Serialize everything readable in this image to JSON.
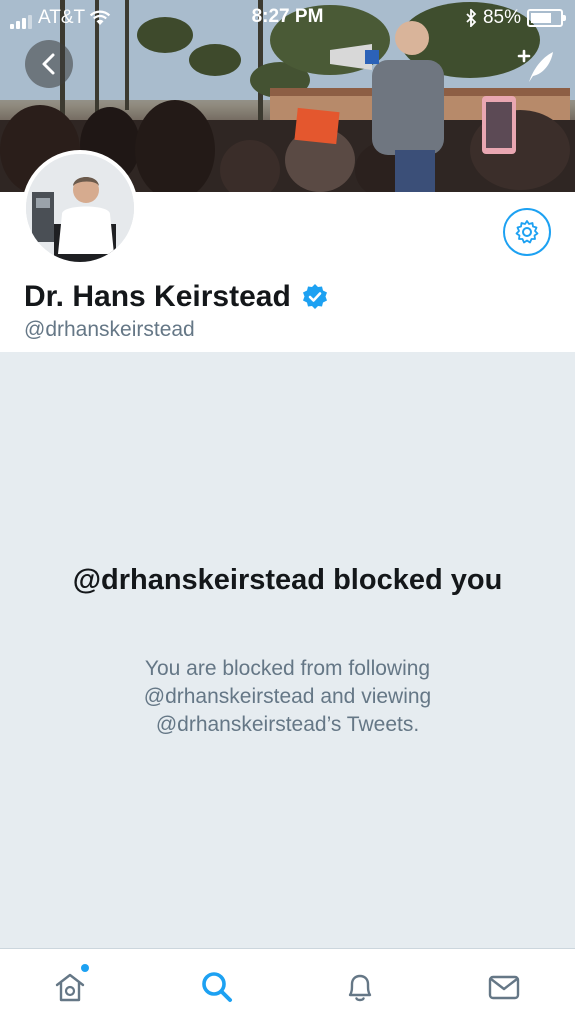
{
  "status_bar": {
    "carrier": "AT&T",
    "time": "8:27 PM",
    "battery": "85%",
    "battery_level": 0.85
  },
  "profile": {
    "name": "Dr. Hans Keirstead",
    "handle": "@drhanskeirstead",
    "verified": true
  },
  "blocked_notice": {
    "title": "@drhanskeirstead blocked you",
    "description": "You are blocked from following @drhanskeirstead and viewing @drhanskeirstead’s Tweets."
  },
  "tab_bar": {
    "items": [
      {
        "icon": "home-icon",
        "active": false,
        "has_notification": true
      },
      {
        "icon": "search-icon",
        "active": true,
        "has_notification": false
      },
      {
        "icon": "bell-icon",
        "active": false,
        "has_notification": false
      },
      {
        "icon": "mail-icon",
        "active": false,
        "has_notification": false
      }
    ]
  },
  "colors": {
    "accent": "#1da1f2",
    "background": "#e6ecf0",
    "text_primary": "#14171a",
    "text_secondary": "#657786"
  }
}
